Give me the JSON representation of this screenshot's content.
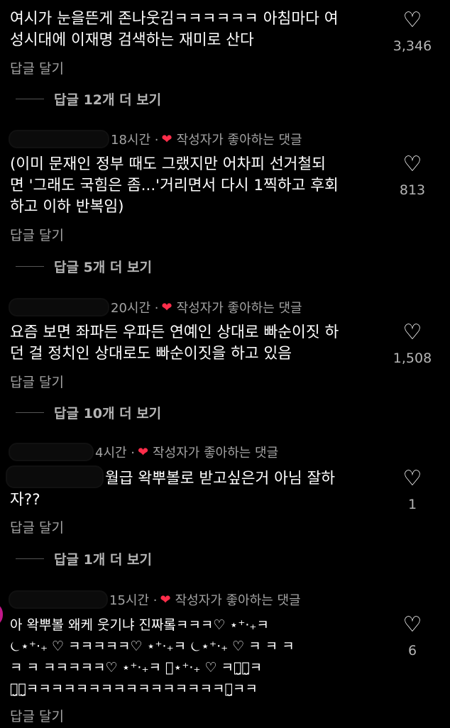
{
  "comments": [
    {
      "meta_time": "",
      "meta_liked": "",
      "text": "여시가 눈을뜬게 존나웃김ㅋㅋㅋㅋㅋㅋ 아침마다 여\n성시대에 이재명 검색하는 재미로 산다",
      "likes": "3,346",
      "reply_label": "답글 달기",
      "more_replies": "답글 12개 더 보기"
    },
    {
      "meta_time": "18시간 ·",
      "meta_liked": "작성자가 좋아하는 댓글",
      "text": "(이미 문재인 정부 때도 그랬지만 어차피 선거철되\n면 '그래도 국힘은 좀...'거리면서 다시 1찍하고 후회\n하고 이하 반복임)",
      "likes": "813",
      "reply_label": "답글 달기",
      "more_replies": "답글 5개 더 보기"
    },
    {
      "meta_time": "20시간 ·",
      "meta_liked": "작성자가 좋아하는 댓글",
      "text": "요즘 보면 좌파든 우파든 연예인 상대로 빠순이짓 하\n던 걸 정치인 상대로도 빠순이짓을 하고 있음",
      "likes": "1,508",
      "reply_label": "답글 달기",
      "more_replies": "답글 10개 더 보기"
    },
    {
      "meta_time": "4시간 ·",
      "meta_liked": "작성자가 좋아하는 댓글",
      "text": "월급 왁뿌볼로 받고싶은거 아님 잘하\n자??",
      "likes": "1",
      "reply_label": "답글 달기",
      "more_replies": "답글 1개 더 보기"
    },
    {
      "meta_time": "15시간 ·",
      "meta_liked": "작성자가 좋아하는 댓글",
      "text": "아 왁뿌볼 왜케 웃기냐 진짜롴ㅋㅋㅋ♡ ⋆⁺‧₊ㅋ\n⏾⋆⁺‧₊ ♡ ㅋㅋㅋㅋㅋ♡ ⋆⁺‧₊ㅋ ⏾⋆⁺‧₊ ♡ ㅋ ㅋ ㅋ\nㅋ ㅋ ㅋㅋㅋㅋㅋ♡ ⋆⁺‧₊ㅋ ⏾⋆⁺‧₊ ♡ ㅋㅋ̤̮ㅋ̤̮ㅋ\nㅋ̤̮ㅋ̤̮ㅋㅋㅋㅋㅋㅋㅋㅋㅋㅋㅋㅋㅋㅋㅋㅋㅋ̤̮ㅋㅋ",
      "likes": "6",
      "reply_label": "답글 달기",
      "more_replies": ""
    }
  ]
}
